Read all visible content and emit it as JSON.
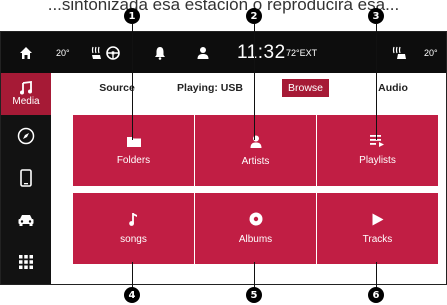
{
  "caption": "...sintonizada esa estación o reproducirá esa...",
  "status_bar": {
    "left_temp": "20°",
    "clock": "11:32",
    "ext_temp": "72°EXT",
    "right_temp": "20°"
  },
  "sidebar": {
    "media_label": "Media"
  },
  "tabs": {
    "source": "Source",
    "playing": "Playing: USB",
    "browse": "Browse",
    "audio": "Audio"
  },
  "tiles": {
    "folders": "Folders",
    "artists": "Artists",
    "playlists": "Playlists",
    "songs": "songs",
    "albums": "Albums",
    "tracks": "Tracks"
  },
  "callouts": [
    "1",
    "2",
    "3",
    "4",
    "5",
    "6"
  ],
  "colors": {
    "accent": "#c11e44",
    "active": "#a61a36",
    "bar": "#0d0d0d"
  }
}
